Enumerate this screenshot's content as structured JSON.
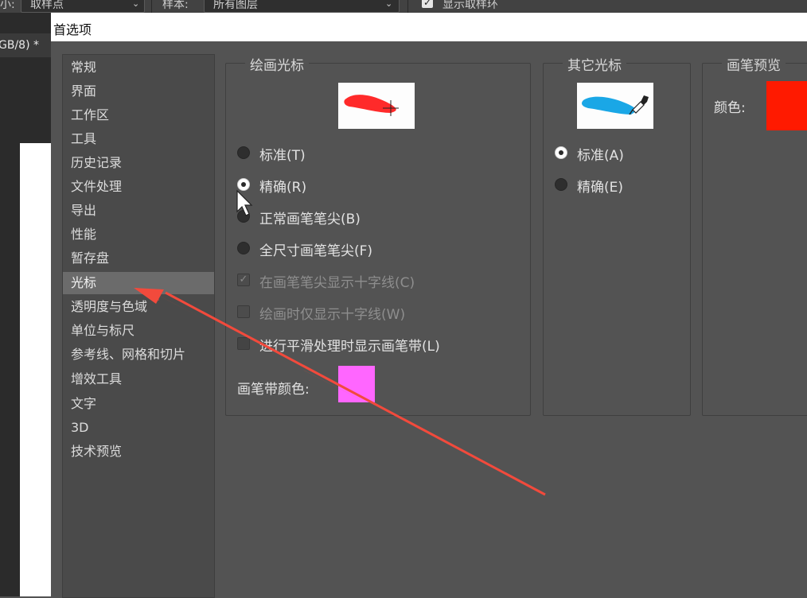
{
  "options_bar": {
    "sample_size_label": "小:",
    "sample_size_value": "取样点",
    "sample_label": "样本:",
    "sample_value": "所有图层",
    "show_ring_label": "显示取样环"
  },
  "document_tab": {
    "label": "GB/8) *"
  },
  "dialog": {
    "title": "首选项",
    "nav_items": [
      "常规",
      "界面",
      "工作区",
      "工具",
      "历史记录",
      "文件处理",
      "导出",
      "性能",
      "暂存盘",
      "光标",
      "透明度与色域",
      "单位与标尺",
      "参考线、网格和切片",
      "增效工具",
      "文字",
      "3D",
      "技术预览"
    ],
    "active_item": "光标",
    "painting_cursors": {
      "title": "绘画光标",
      "preview_icon": "red-brush-stroke-crosshair",
      "options": [
        {
          "label": "标准(T)",
          "selected": false
        },
        {
          "label": "精确(R)",
          "selected": true
        },
        {
          "label": "正常画笔笔尖(B)",
          "selected": false
        },
        {
          "label": "全尺寸画笔笔尖(F)",
          "selected": false
        }
      ],
      "checkboxes": [
        {
          "label": "在画笔笔尖显示十字线(C)",
          "checked": true,
          "disabled": true
        },
        {
          "label": "绘画时仅显示十字线(W)",
          "checked": false,
          "disabled": true
        },
        {
          "label": "进行平滑处理时显示画笔带(L)",
          "checked": false,
          "disabled": false
        }
      ],
      "brush_leash_color_label": "画笔带颜色:",
      "brush_leash_color": "#ff66ff"
    },
    "other_cursors": {
      "title": "其它光标",
      "preview_icon": "blue-stroke-eyedropper",
      "options": [
        {
          "label": "标准(A)",
          "selected": true
        },
        {
          "label": "精确(E)",
          "selected": false
        }
      ]
    },
    "brush_preview": {
      "title": "画笔预览",
      "color_label": "颜色:",
      "color": "#ff1a00"
    }
  },
  "colors": {
    "accent_red": "#ff2a2a",
    "annotation_arrow": "#f24a3c"
  }
}
